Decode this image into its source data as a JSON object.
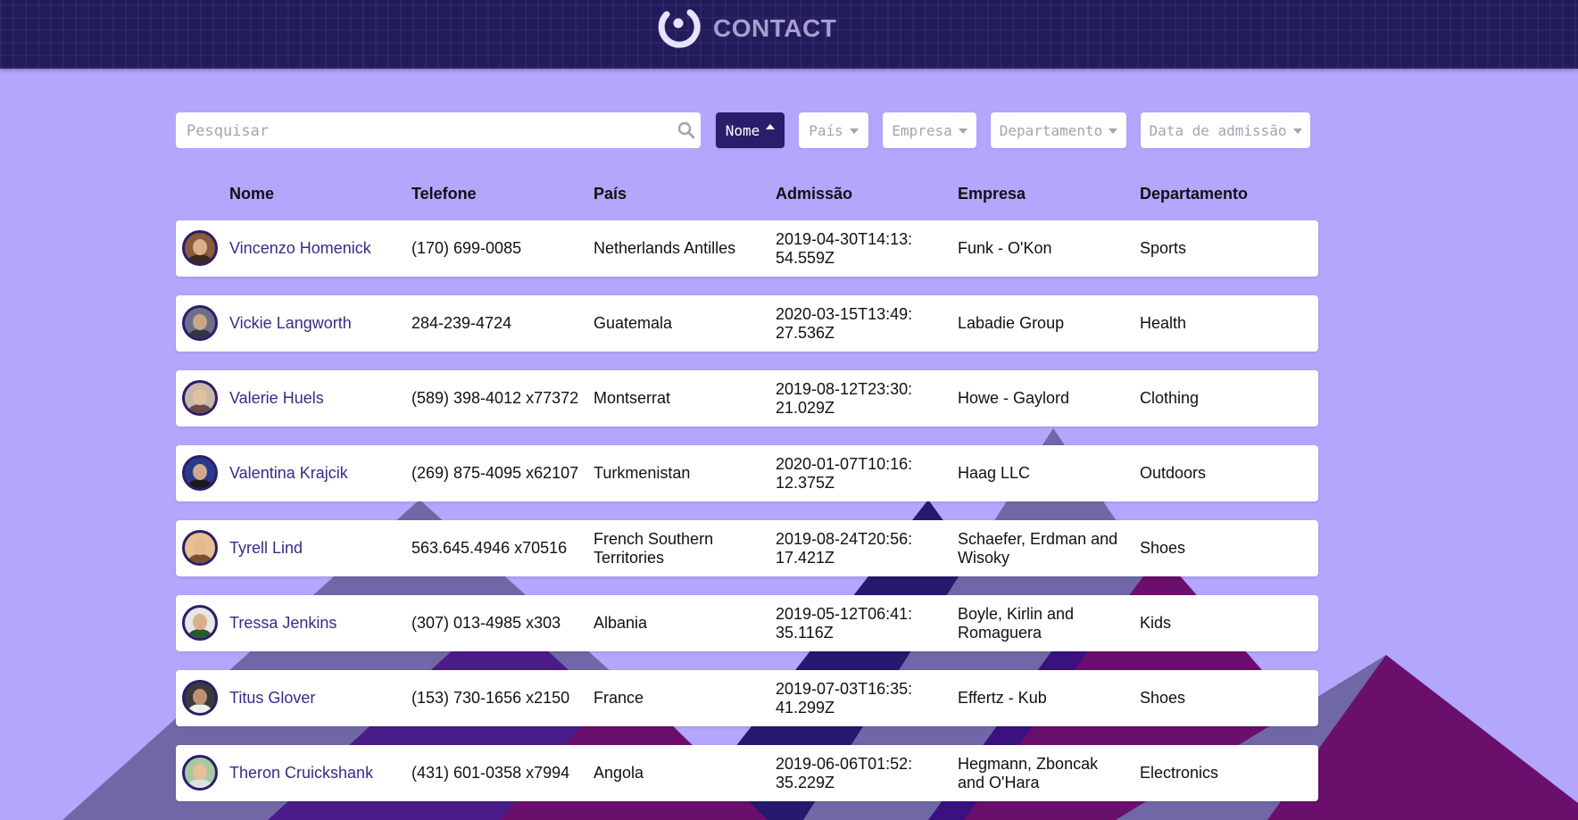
{
  "header": {
    "brand": "CONTACT",
    "logo_icon": "contact-logo-icon"
  },
  "toolbar": {
    "search": {
      "placeholder": "Pesquisar",
      "value": "",
      "icon": "search-icon"
    },
    "filters": [
      {
        "label": "Nome",
        "active": true,
        "sort": "asc"
      },
      {
        "label": "País",
        "active": false
      },
      {
        "label": "Empresa",
        "active": false
      },
      {
        "label": "Departamento",
        "active": false
      },
      {
        "label": "Data de admissão",
        "active": false
      }
    ]
  },
  "table": {
    "columns": [
      "Nome",
      "Telefone",
      "País",
      "Admissão",
      "Empresa",
      "Departamento"
    ],
    "rows": [
      {
        "name": "Vincenzo Homenick",
        "phone": "(170) 699-0085",
        "country": "Netherlands Antilles",
        "admission": "2019-04-30T14:13:54.559Z",
        "company": "Funk - O'Kon",
        "department": "Sports"
      },
      {
        "name": "Vickie Langworth",
        "phone": "284-239-4724",
        "country": "Guatemala",
        "admission": "2020-03-15T13:49:27.536Z",
        "company": "Labadie Group",
        "department": "Health"
      },
      {
        "name": "Valerie Huels",
        "phone": "(589) 398-4012 x77372",
        "country": "Montserrat",
        "admission": "2019-08-12T23:30:21.029Z",
        "company": "Howe - Gaylord",
        "department": "Clothing"
      },
      {
        "name": "Valentina Krajcik",
        "phone": "(269) 875-4095 x62107",
        "country": "Turkmenistan",
        "admission": "2020-01-07T10:16:12.375Z",
        "company": "Haag LLC",
        "department": "Outdoors"
      },
      {
        "name": "Tyrell Lind",
        "phone": "563.645.4946 x70516",
        "country": "French Southern Territories",
        "admission": "2019-08-24T20:56:17.421Z",
        "company": "Schaefer, Erdman and Wisoky",
        "department": "Shoes"
      },
      {
        "name": "Tressa Jenkins",
        "phone": "(307) 013-4985 x303",
        "country": "Albania",
        "admission": "2019-05-12T06:41:35.116Z",
        "company": "Boyle, Kirlin and Romaguera",
        "department": "Kids"
      },
      {
        "name": "Titus Glover",
        "phone": "(153) 730-1656 x2150",
        "country": "France",
        "admission": "2019-07-03T16:35:41.299Z",
        "company": "Effertz - Kub",
        "department": "Shoes"
      },
      {
        "name": "Theron Cruickshank",
        "phone": "(431) 601-0358 x7994",
        "country": "Angola",
        "admission": "2019-06-06T01:52:35.229Z",
        "company": "Hegmann, Zboncak and O'Hara",
        "department": "Electronics"
      }
    ]
  },
  "colors": {
    "background": "#b2a6fd",
    "header": "#221b5c",
    "accent": "#2a1e6b",
    "name_link": "#3b2a8a",
    "mountain_light": "#7068a6",
    "mountain_dark": "#3a1280",
    "mountain_magenta": "#6a0f6c"
  }
}
